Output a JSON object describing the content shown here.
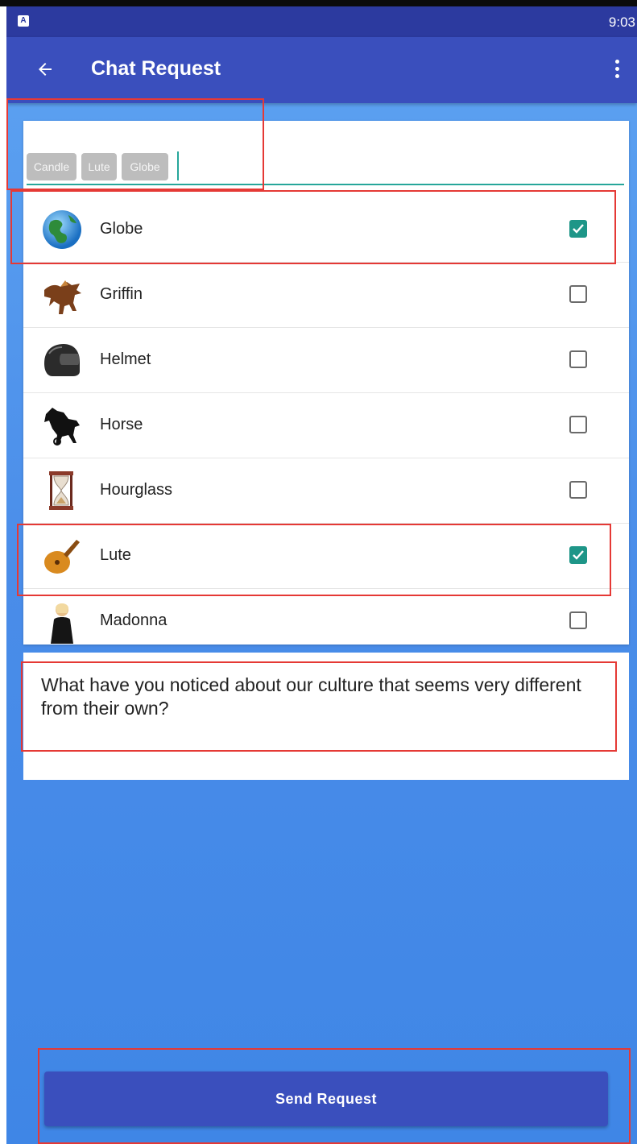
{
  "status_bar": {
    "icon": "A",
    "time": "9:03"
  },
  "app_bar": {
    "title": "Chat Request",
    "back_icon": "arrow-left-icon",
    "menu_icon": "more-vert-icon"
  },
  "chips": [
    "Candle",
    "Lute",
    "Globe"
  ],
  "contacts": [
    {
      "name": "Globe",
      "checked": true,
      "icon": "globe"
    },
    {
      "name": "Griffin",
      "checked": false,
      "icon": "griffin"
    },
    {
      "name": "Helmet",
      "checked": false,
      "icon": "helmet"
    },
    {
      "name": "Horse",
      "checked": false,
      "icon": "horse"
    },
    {
      "name": "Hourglass",
      "checked": false,
      "icon": "hourglass"
    },
    {
      "name": "Lute",
      "checked": true,
      "icon": "lute"
    },
    {
      "name": "Madonna",
      "checked": false,
      "icon": "madonna"
    }
  ],
  "message": {
    "text": "What have you noticed about our culture that seems very different from  their own?"
  },
  "send_button": {
    "label": "Send Request"
  },
  "colors": {
    "app_bar": "#3a4fbd",
    "status_bar": "#2c3a9f",
    "accent": "#26a69a",
    "checkbox_checked": "#1e9688",
    "highlight": "#e53935"
  }
}
